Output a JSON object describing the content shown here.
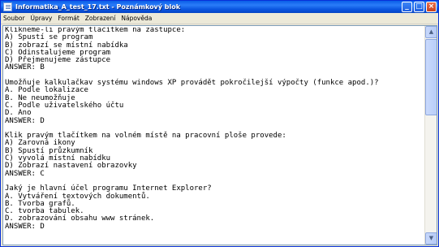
{
  "window": {
    "title": "Informatika_A_test_17.txt - Poznámkový blok",
    "minimize_label": "_",
    "maximize_label": "□",
    "close_label": "×"
  },
  "menu": {
    "items": [
      "Soubor",
      "Úpravy",
      "Formát",
      "Zobrazení",
      "Nápověda"
    ]
  },
  "document": {
    "lines": [
      "Klikneme-li pravým tlačítkem na zástupce:",
      "A) Spustí se program",
      "B) zobrazí se místní nabídka",
      "C) Odinstalujeme program",
      "D) Přejmenujeme zástupce",
      "ANSWER: B",
      "",
      "Umožňuje kalkulačkav systému windows XP provádět pokročilejší výpočty (funkce apod.)?",
      "A. Podle lokalizace",
      "B. Ne neumožňuje",
      "C. Podle uživatelského účtu",
      "D. Ano",
      "ANSWER: D",
      "",
      "Klik pravým tlačítkem na volném místě na pracovní ploše provede:",
      "A) Zarovná ikony",
      "B) Spustí průzkumník",
      "C) vyvolá místní nabídku",
      "D) Zobrazí nastavení obrazovky",
      "ANSWER: C",
      "",
      "Jaký je hlavní účel programu Internet Explorer?",
      "A. Vytváření textových dokumentů.",
      "B. Tvorba grafů.",
      "C. tvorba tabulek.",
      "D. zobrazování obsahu www stránek.",
      "ANSWER: D"
    ]
  },
  "scrollbar": {
    "up_arrow": "▲",
    "down_arrow": "▼"
  }
}
